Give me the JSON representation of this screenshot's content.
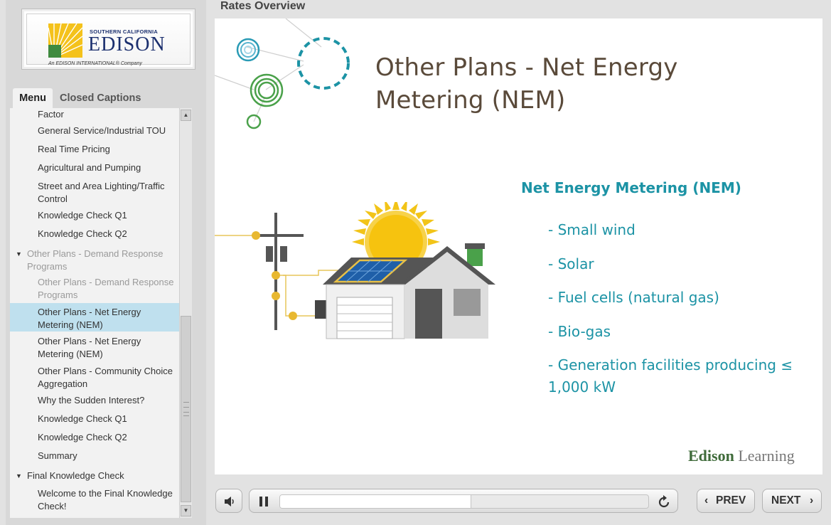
{
  "logo": {
    "small": "SOUTHERN CALIFORNIA",
    "main": "EDISON",
    "sub": "An EDISON INTERNATIONAL® Company"
  },
  "tabs": {
    "menu": "Menu",
    "captions": "Closed Captions"
  },
  "menu": {
    "items": [
      {
        "label": "Factor"
      },
      {
        "label": "General Service/Industrial TOU"
      },
      {
        "label": "Real Time Pricing"
      },
      {
        "label": "Agricultural and Pumping"
      },
      {
        "label": "Street and Area Lighting/Traffic Control"
      },
      {
        "label": "Knowledge Check Q1"
      },
      {
        "label": "Knowledge Check Q2"
      },
      {
        "label": "Other Plans - Demand Response Programs"
      },
      {
        "label": "Other Plans - Demand Response Programs"
      },
      {
        "label": "Other Plans - Net Energy Metering (NEM)"
      },
      {
        "label": "Other Plans - Net Energy Metering (NEM)"
      },
      {
        "label": "Other Plans - Community Choice Aggregation"
      },
      {
        "label": "Why the Sudden Interest?"
      },
      {
        "label": "Knowledge Check Q1"
      },
      {
        "label": "Knowledge Check Q2"
      },
      {
        "label": "Summary"
      },
      {
        "label": "Final Knowledge Check"
      },
      {
        "label": "Welcome to the Final Knowledge Check!"
      }
    ]
  },
  "header": {
    "course_title": "Rates Overview"
  },
  "slide": {
    "title": "Other Plans - Net Energy Metering (NEM)",
    "heading": "Net Energy Metering (NEM)",
    "bullets": [
      "- Small wind",
      "- Solar",
      "- Fuel cells (natural gas)",
      "- Bio-gas",
      "- Generation facilities producing ≤ 1,000 kW"
    ],
    "brand_1": "Edison",
    "brand_2": "Learning"
  },
  "controls": {
    "prev": "PREV",
    "next": "NEXT",
    "progress": 0.52
  },
  "colors": {
    "accent_teal": "#1c93a5",
    "title_brown": "#5a4a3a",
    "active_row": "#bfe0ee"
  }
}
